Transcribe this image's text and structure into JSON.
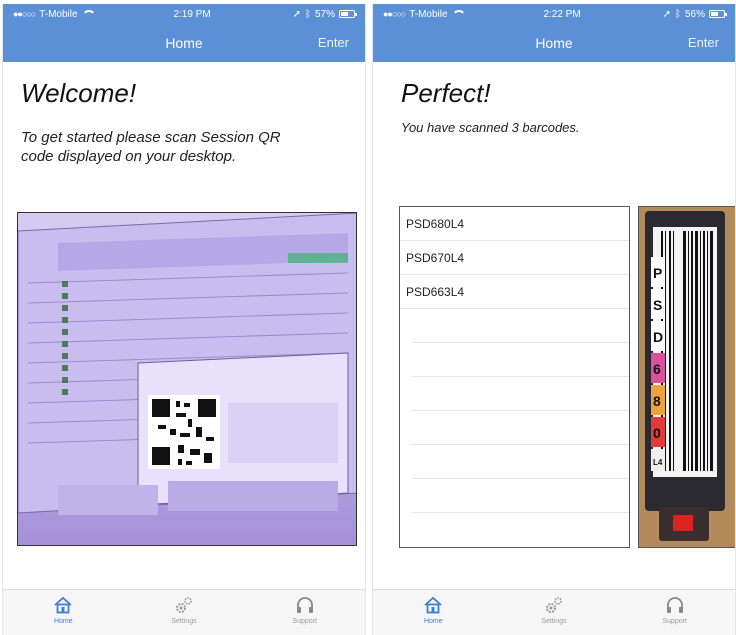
{
  "left_screen": {
    "status": {
      "carrier": "T-Mobile",
      "time": "2:19 PM",
      "battery": "57%",
      "battery_level": 0.57
    },
    "nav": {
      "title": "Home",
      "action": "Enter"
    },
    "heading": "Welcome!",
    "instructions": "To get started please scan Session QR code displayed on your desktop."
  },
  "right_screen": {
    "status": {
      "carrier": "T-Mobile",
      "time": "2:22 PM",
      "battery": "56%",
      "battery_level": 0.56
    },
    "nav": {
      "title": "Home",
      "action": "Enter"
    },
    "heading": "Perfect!",
    "subline": "You have scanned 3 barcodes.",
    "barcodes": [
      "PSD680L4",
      "PSD670L4",
      "PSD663L4"
    ],
    "tape_label_letters": [
      "P",
      "S",
      "D",
      "6",
      "8",
      "0",
      "L4"
    ]
  },
  "tabbar": {
    "home": "Home",
    "settings": "Settings",
    "support": "Support"
  },
  "colors": {
    "nav_bar": "#5b8fd6",
    "active_tab": "#3b7ddd"
  }
}
